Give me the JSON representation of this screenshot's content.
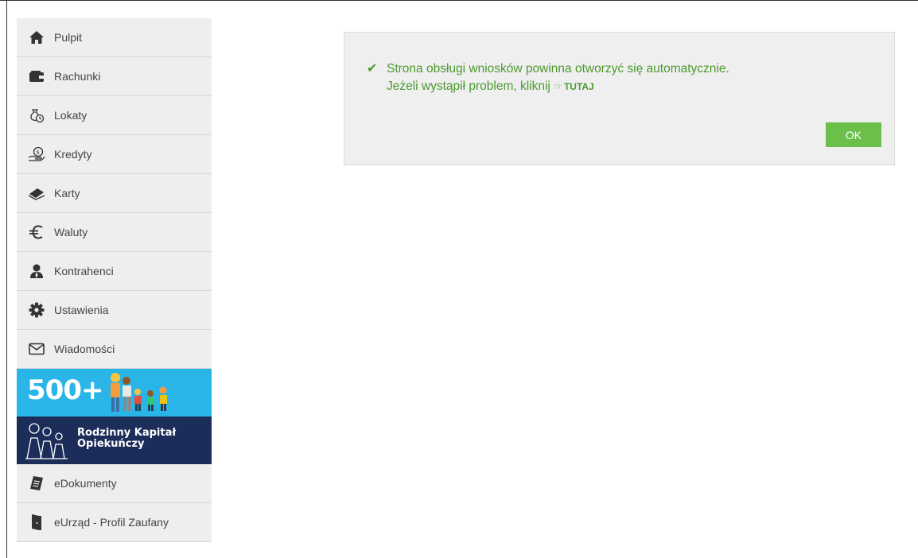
{
  "sidebar": {
    "items": [
      {
        "label": "Pulpit",
        "icon": "home-icon"
      },
      {
        "label": "Rachunki",
        "icon": "wallet-icon"
      },
      {
        "label": "Lokaty",
        "icon": "deposit-icon"
      },
      {
        "label": "Kredyty",
        "icon": "loan-icon"
      },
      {
        "label": "Karty",
        "icon": "card-icon"
      },
      {
        "label": "Waluty",
        "icon": "euro-icon"
      },
      {
        "label": "Kontrahenci",
        "icon": "contact-icon"
      },
      {
        "label": "Ustawienia",
        "icon": "gear-icon"
      },
      {
        "label": "Wiadomości",
        "icon": "envelope-icon"
      }
    ],
    "banners": {
      "program_500": {
        "text": "500+"
      },
      "rkp": {
        "line1": "Rodzinny Kapitał",
        "line2": "Opiekuńczy"
      }
    },
    "bottom_items": [
      {
        "label": "eDokumenty",
        "icon": "document-icon"
      },
      {
        "label": "eUrząd - Profil Zaufany",
        "icon": "door-icon"
      }
    ]
  },
  "dialog": {
    "line1": "Strona obsługi wniosków powinna otworzyć się automatycznie.",
    "line2": "Jeżeli wystąpił problem, kliknij",
    "link": "TUTAJ",
    "ok_label": "OK"
  },
  "colors": {
    "success_green": "#4a9a2e",
    "ok_button": "#6cc04a",
    "sidebar_bg": "#eeeeee",
    "banner_500_bg": "#29b5e8",
    "banner_rkp_bg": "#1c2d5a"
  }
}
